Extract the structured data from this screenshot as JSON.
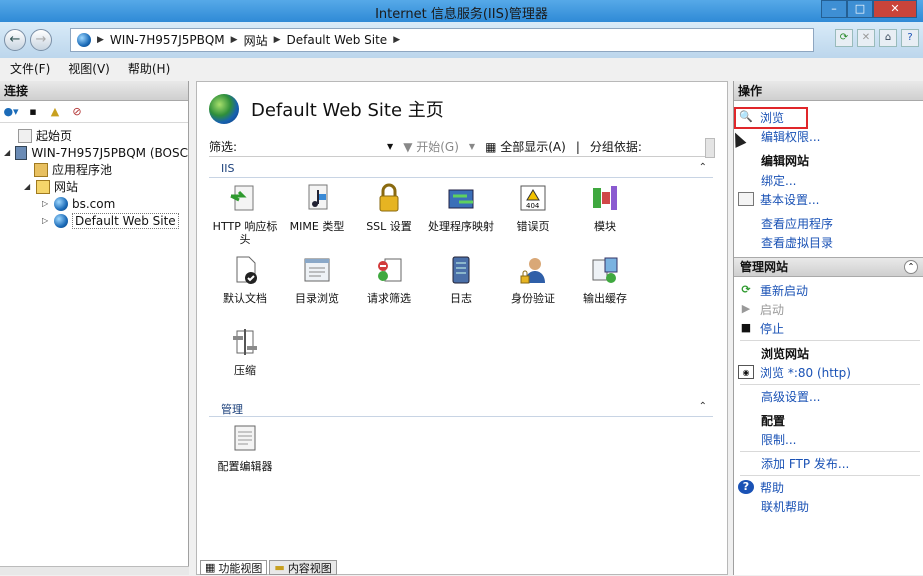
{
  "window": {
    "title": "Internet 信息服务(IIS)管理器"
  },
  "address": {
    "segments": [
      "WIN-7H957J5PBQM",
      "网站",
      "Default Web Site"
    ]
  },
  "menu": {
    "items": [
      "文件(F)",
      "视图(V)",
      "帮助(H)"
    ]
  },
  "connections": {
    "title": "连接",
    "tree": [
      {
        "label": "起始页",
        "level": 0
      },
      {
        "label": "WIN-7H957J5PBQM (BOSC",
        "level": 0
      },
      {
        "label": "应用程序池",
        "level": 1
      },
      {
        "label": "网站",
        "level": 1
      },
      {
        "label": "bs.com",
        "level": 2
      },
      {
        "label": "Default Web Site",
        "level": 2
      }
    ]
  },
  "center": {
    "title": "Default Web Site 主页",
    "filter": {
      "label": "筛选:",
      "start": "开始(G)",
      "show_all": "全部显示(A)",
      "group_by": "分组依据:"
    },
    "iis_section": "IIS",
    "manage_section": "管理",
    "features": [
      {
        "label": "HTTP 响应标头",
        "icon": "http-headers-icon"
      },
      {
        "label": "MIME 类型",
        "icon": "mime-types-icon"
      },
      {
        "label": "SSL 设置",
        "icon": "ssl-lock-icon"
      },
      {
        "label": "处理程序映射",
        "icon": "handler-mappings-icon"
      },
      {
        "label": "错误页",
        "icon": "error-pages-icon"
      },
      {
        "label": "模块",
        "icon": "modules-icon"
      },
      {
        "label": "默认文档",
        "icon": "default-document-icon"
      },
      {
        "label": "目录浏览",
        "icon": "directory-browsing-icon"
      },
      {
        "label": "请求筛选",
        "icon": "request-filtering-icon"
      },
      {
        "label": "日志",
        "icon": "logging-icon"
      },
      {
        "label": "身份验证",
        "icon": "authentication-icon"
      },
      {
        "label": "输出缓存",
        "icon": "output-caching-icon"
      },
      {
        "label": "压缩",
        "icon": "compression-icon"
      }
    ],
    "manage_features": [
      {
        "label": "配置编辑器",
        "icon": "configuration-editor-icon"
      }
    ],
    "error_page_badge": "404",
    "bottom_tabs": [
      "功能视图",
      "内容视图"
    ]
  },
  "actions": {
    "title": "操作",
    "explore": "浏览",
    "edit_permissions": "编辑权限...",
    "edit_site": "编辑网站",
    "bindings": "绑定...",
    "basic_settings": "基本设置...",
    "view_apps": "查看应用程序",
    "view_vdirs": "查看虚拟目录",
    "manage_site": "管理网站",
    "restart": "重新启动",
    "start": "启动",
    "stop": "停止",
    "browse_site": "浏览网站",
    "browse_80": "浏览 *:80 (http)",
    "advanced_settings": "高级设置...",
    "configure": "配置",
    "limits": "限制...",
    "add_ftp": "添加 FTP 发布...",
    "help": "帮助",
    "online_help": "联机帮助"
  }
}
